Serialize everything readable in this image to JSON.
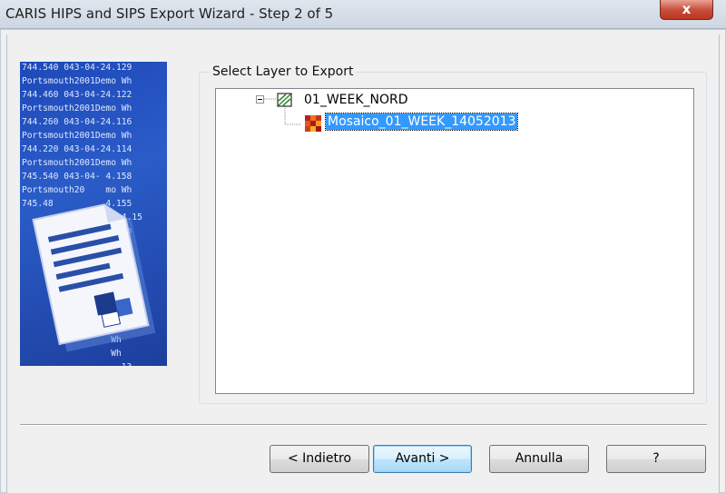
{
  "window": {
    "title": "CARIS HIPS and SIPS Export Wizard - Step 2 of 5",
    "close_label": "x"
  },
  "banner_text": [
    "744.540 043-04-24.129",
    "Portsmouth2001Demo Wh",
    "744.460 043-04-24.122",
    "Portsmouth2001Demo Wh",
    "744.260 043-04-24.116",
    "Portsmouth2001Demo Wh",
    "744.220 043-04-24.114",
    "Portsmouth2001Demo Wh",
    "745.540 043-04- 4.158",
    "Portsmouth20    mo Wh",
    "745.48          4.155",
    "                   4.15",
    "                   Wh",
    "                    1",
    "                   Wh",
    "                   3",
    "                   Wh",
    "                   .1",
    "                  Wh",
    "                  .1",
    "                 Wh",
    "                 Wh",
    "                  .13"
  ],
  "group": {
    "label": "Select Layer to Export"
  },
  "tree": {
    "root": {
      "label": "01_WEEK_NORD"
    },
    "child": {
      "label": "Mosaico_01_WEEK_14052013"
    }
  },
  "buttons": {
    "back": "< Indietro",
    "next": "Avanti >",
    "cancel": "Annulla",
    "help": "?"
  }
}
